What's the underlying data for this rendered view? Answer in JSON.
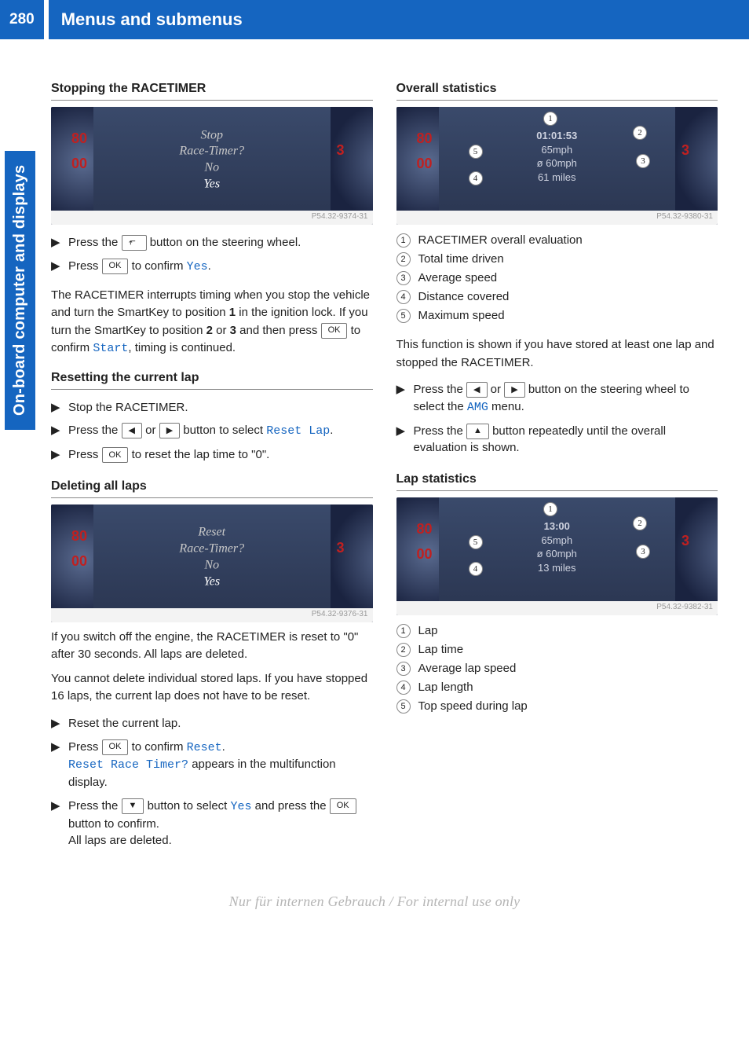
{
  "header": {
    "page_number": "280",
    "title": "Menus and submenus"
  },
  "sidebar_tab": "On-board computer and displays",
  "buttons": {
    "ok": "OK"
  },
  "left": {
    "stopping": {
      "heading": "Stopping the RACETIMER",
      "fig": {
        "l1": "Stop",
        "l2": "Race-Timer?",
        "l3": "No",
        "l4": "Yes",
        "gauge_left_1": "80",
        "gauge_left_2": "00",
        "gauge_right": "3",
        "ref": "P54.32-9374-31"
      },
      "steps": [
        {
          "pre": "Press the ",
          "btn": "back",
          "post": " button on the steering wheel."
        },
        {
          "pre": "Press ",
          "btn": "ok",
          "post_pre": " to confirm ",
          "mono": "Yes",
          "post_post": "."
        }
      ],
      "para": {
        "t1": "The RACETIMER interrupts timing when you stop the vehicle and turn the SmartKey to position ",
        "b1": "1",
        "t2": " in the ignition lock. If you turn the SmartKey to position ",
        "b2": "2",
        "t3": " or ",
        "b3": "3",
        "t4": " and then press ",
        "btn": "ok",
        "t5": " to confirm ",
        "mono": "Start",
        "t6": ", timing is continued."
      }
    },
    "resetting": {
      "heading": "Resetting the current lap",
      "steps": [
        {
          "text": "Stop the RACETIMER."
        },
        {
          "pre": "Press the ",
          "btn1": "left",
          "mid": " or ",
          "btn2": "right",
          "post_pre": " button to select ",
          "mono": "Reset Lap",
          "post_post": "."
        },
        {
          "pre": "Press ",
          "btn": "ok",
          "post": " to reset the lap time to \"0\"."
        }
      ]
    },
    "deleting": {
      "heading": "Deleting all laps",
      "fig": {
        "l1": "Reset",
        "l2": "Race-Timer?",
        "l3": "No",
        "l4": "Yes",
        "gauge_left_1": "80",
        "gauge_left_2": "00",
        "gauge_right": "3",
        "ref": "P54.32-9376-31"
      },
      "para1": "If you switch off the engine, the RACETIMER is reset to \"0\" after 30 seconds. All laps are deleted.",
      "para2": "You cannot delete individual stored laps. If you have stopped 16 laps, the current lap does not have to be reset.",
      "steps": [
        {
          "text": "Reset the current lap."
        },
        {
          "pre": "Press ",
          "btn": "ok",
          "post_pre": " to confirm ",
          "mono": "Reset",
          "post_post": ".",
          "extra_mono": "Reset Race Timer?",
          "extra_text": " appears in the multifunction display."
        },
        {
          "pre": "Press the ",
          "btn1": "down",
          "mid_pre": " button to select ",
          "mono": "Yes",
          "mid_post": " and press the ",
          "btn2": "ok",
          "post": " button to confirm.",
          "after": "All laps are deleted."
        }
      ]
    }
  },
  "right": {
    "overall": {
      "heading": "Overall statistics",
      "fig": {
        "top": "01:01:53",
        "speed1": "65mph",
        "speed2": "ø 60mph",
        "dist": "61 miles",
        "gauge_left_1": "80",
        "gauge_left_2": "00",
        "gauge_right": "3",
        "ref": "P54.32-9380-31"
      },
      "legend": [
        "RACETIMER overall evaluation",
        "Total time driven",
        "Average speed",
        "Distance covered",
        "Maximum speed"
      ],
      "para": "This function is shown if you have stored at least one lap and stopped the RACETIMER.",
      "steps": [
        {
          "pre": "Press the ",
          "btn1": "left",
          "mid": " or ",
          "btn2": "right",
          "post_pre": " button on the steering wheel to select the ",
          "mono": "AMG",
          "post_post": " menu."
        },
        {
          "pre": "Press the ",
          "btn": "up",
          "post": " button repeatedly until the overall evaluation is shown."
        }
      ]
    },
    "lap": {
      "heading": "Lap statistics",
      "fig": {
        "top": "13:00",
        "speed1": "65mph",
        "speed2": "ø 60mph",
        "dist": "13 miles",
        "gauge_left_1": "80",
        "gauge_left_2": "00",
        "gauge_right": "3",
        "ref": "P54.32-9382-31"
      },
      "legend": [
        "Lap",
        "Lap time",
        "Average lap speed",
        "Lap length",
        "Top speed during lap"
      ]
    }
  },
  "watermark": "Nur für internen Gebrauch / For internal use only"
}
